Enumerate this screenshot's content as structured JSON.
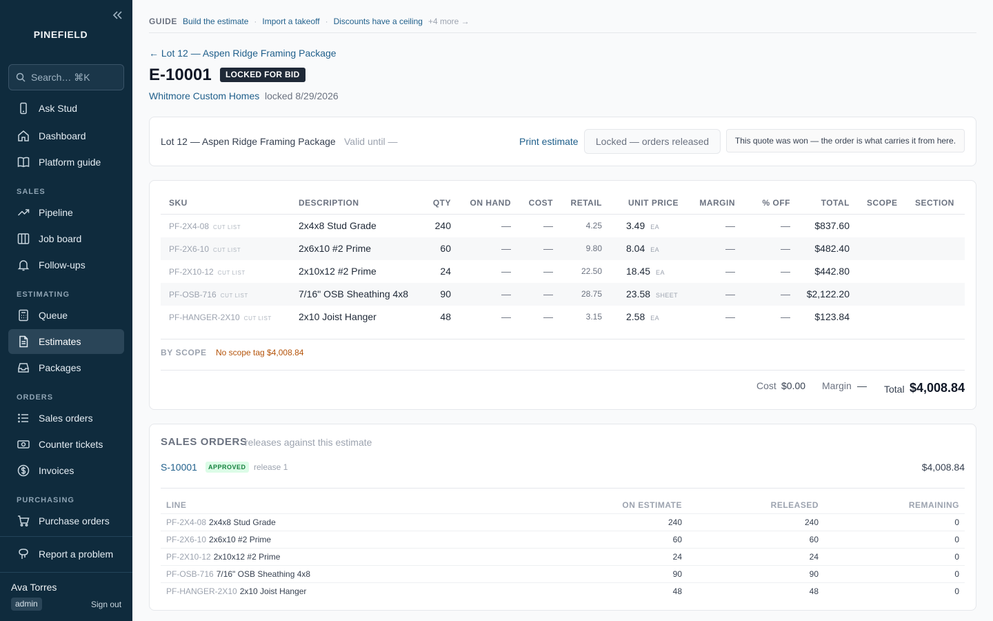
{
  "sidebar": {
    "brand": "PINEFIELD",
    "search_placeholder": "Search… ⌘K",
    "ask": "Ask Stud",
    "dashboard": "Dashboard",
    "platform_guide": "Platform guide",
    "sections": {
      "sales": "SALES",
      "estimating": "ESTIMATING",
      "orders": "ORDERS",
      "purchasing": "PURCHASING"
    },
    "pipeline": "Pipeline",
    "job_board": "Job board",
    "follow_ups": "Follow-ups",
    "queue": "Queue",
    "estimates": "Estimates",
    "packages": "Packages",
    "sales_orders": "Sales orders",
    "counter_tickets": "Counter tickets",
    "invoices": "Invoices",
    "purchase_orders": "Purchase orders",
    "report": "Report a problem",
    "user_name": "Ava Torres",
    "user_role": "admin",
    "sign_out": "Sign out"
  },
  "guide": {
    "label": "GUIDE",
    "links": [
      "Build the estimate",
      "Import a takeoff",
      "Discounts have a ceiling"
    ],
    "more": "+4 more →"
  },
  "estimate": {
    "back_link": "← Lot 12 — Aspen Ridge Framing Package",
    "number": "E-10001",
    "status": "LOCKED FOR BID",
    "customer": "Whitmore Custom Homes",
    "locked": "locked 8/29/2026",
    "package_name": "Lot 12 — Aspen Ridge Framing Package",
    "valid_until": "Valid until —",
    "print": "Print estimate",
    "locked_button": "Locked — orders released",
    "won_note": "This quote was won — the order is what carries it from here."
  },
  "line_table": {
    "headers": {
      "sku": "SKU",
      "description": "DESCRIPTION",
      "qty": "QTY",
      "on_hand": "ON HAND",
      "cost": "COST",
      "retail": "RETAIL",
      "unit_price": "UNIT PRICE",
      "margin": "MARGIN",
      "pct_off": "% OFF",
      "total": "TOTAL",
      "scope": "SCOPE",
      "section": "SECTION"
    },
    "rows": [
      {
        "sku": "PF-2X4-08",
        "tag": "CUT LIST",
        "description": "2x4x8 Stud Grade",
        "qty": "240",
        "on_hand": "—",
        "cost": "—",
        "retail": "4.25",
        "unit_price": "3.49",
        "unit": "EA",
        "margin": "—",
        "pct_off": "—",
        "total": "$837.60"
      },
      {
        "sku": "PF-2X6-10",
        "tag": "CUT LIST",
        "description": "2x6x10 #2 Prime",
        "qty": "60",
        "on_hand": "—",
        "cost": "—",
        "retail": "9.80",
        "unit_price": "8.04",
        "unit": "EA",
        "margin": "—",
        "pct_off": "—",
        "total": "$482.40"
      },
      {
        "sku": "PF-2X10-12",
        "tag": "CUT LIST",
        "description": "2x10x12 #2 Prime",
        "qty": "24",
        "on_hand": "—",
        "cost": "—",
        "retail": "22.50",
        "unit_price": "18.45",
        "unit": "EA",
        "margin": "—",
        "pct_off": "—",
        "total": "$442.80"
      },
      {
        "sku": "PF-OSB-716",
        "tag": "CUT LIST",
        "description": "7/16\" OSB Sheathing 4x8",
        "qty": "90",
        "on_hand": "—",
        "cost": "—",
        "retail": "28.75",
        "unit_price": "23.58",
        "unit": "SHEET",
        "margin": "—",
        "pct_off": "—",
        "total": "$2,122.20"
      },
      {
        "sku": "PF-HANGER-2X10",
        "tag": "CUT LIST",
        "description": "2x10 Joist Hanger",
        "qty": "48",
        "on_hand": "—",
        "cost": "—",
        "retail": "3.15",
        "unit_price": "2.58",
        "unit": "EA",
        "margin": "—",
        "pct_off": "—",
        "total": "$123.84"
      }
    ],
    "by_scope_label": "BY SCOPE",
    "by_scope_value": "No scope tag $4,008.84",
    "totals": {
      "cost_label": "Cost",
      "cost": "$0.00",
      "margin_label": "Margin",
      "margin": "—",
      "total_label": "Total",
      "total": "$4,008.84"
    }
  },
  "sales_orders": {
    "title": "SALES ORDERS",
    "subtitle": "releases against this estimate",
    "order_number": "S-10001",
    "order_status": "APPROVED",
    "release": "release 1",
    "amount": "$4,008.84",
    "headers": {
      "line": "LINE",
      "on_estimate": "ON ESTIMATE",
      "released": "RELEASED",
      "remaining": "REMAINING"
    },
    "rows": [
      {
        "sku": "PF-2X4-08",
        "description": "2x4x8 Stud Grade",
        "on_estimate": "240",
        "released": "240",
        "remaining": "0"
      },
      {
        "sku": "PF-2X6-10",
        "description": "2x6x10 #2 Prime",
        "on_estimate": "60",
        "released": "60",
        "remaining": "0"
      },
      {
        "sku": "PF-2X10-12",
        "description": "2x10x12 #2 Prime",
        "on_estimate": "24",
        "released": "24",
        "remaining": "0"
      },
      {
        "sku": "PF-OSB-716",
        "description": "7/16\" OSB Sheathing 4x8",
        "on_estimate": "90",
        "released": "90",
        "remaining": "0"
      },
      {
        "sku": "PF-HANGER-2X10",
        "description": "2x10 Joist Hanger",
        "on_estimate": "48",
        "released": "48",
        "remaining": "0"
      }
    ]
  },
  "colors": {
    "sidebar_bg": "#0f2b3d",
    "link": "#1f5f8b",
    "badge_dark": "#1f2937",
    "approved_bg": "#dcfce7",
    "approved_text": "#15803d",
    "scope_warning": "#b45309"
  }
}
